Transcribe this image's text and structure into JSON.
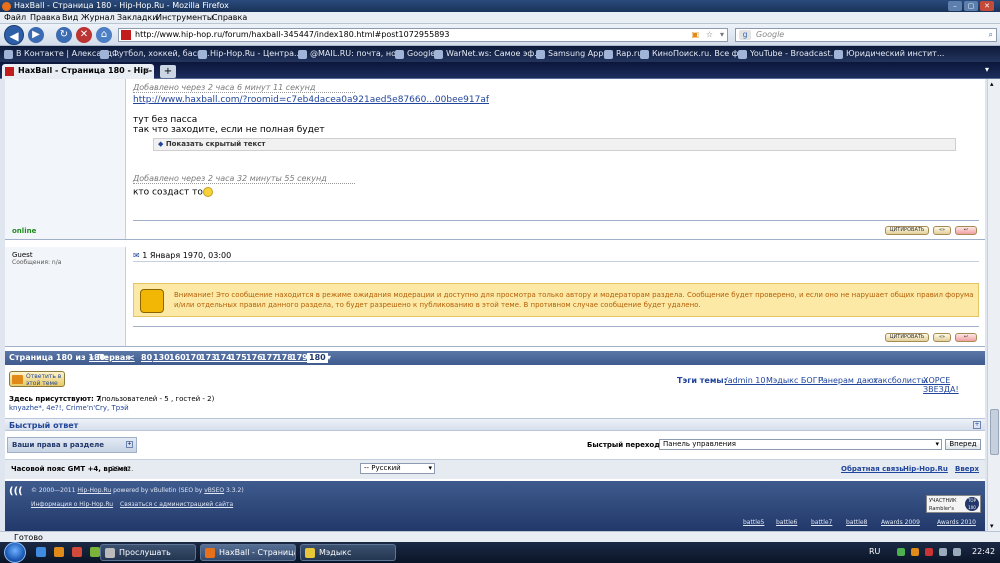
{
  "window": {
    "title": "HaxBall - Страница 180 - Hip-Hop.Ru - Mozilla Firefox"
  },
  "menu": [
    "Файл",
    "Правка",
    "Вид",
    "Журнал",
    "Закладки",
    "Инструменты",
    "Справка"
  ],
  "nav": {
    "url": "http://www.hip-hop.ru/forum/haxball-345447/index180.html#post1072955893",
    "search_placeholder": "Google"
  },
  "bookmarks": [
    "В Контакте | Александ...",
    "Футбол, хоккей, баск...",
    "Hip-Hop.Ru - Центра...",
    "@MAIL.RU: почта, но...",
    "Google",
    "WarNet.ws: Самое эф...",
    "Samsung Apps",
    "Rap.ru",
    "КиноПоиск.ru. Все ф...",
    "YouTube - Broadcast...",
    "Юридический инстит..."
  ],
  "tab": {
    "title": "HaxBall - Страница 180 - Hip-Hop.Ru",
    "new_tab_label": "+"
  },
  "post1": {
    "added1": "Добавлено через 2 часа 6 минут 11 секунд",
    "link": "http://www.haxball.com/?roomid=c7eb4dacea0a921aed5e87660...00bee917af",
    "line1": "тут без пасса",
    "line2": "так что заходите, если не полная будет",
    "hidden_label": "Показать скрытый текст",
    "added2": "Добавлено через 2 часа 32 минуты 55 секунд",
    "line3": "кто создаст то",
    "status": "online",
    "quote_label": "ЦИТИРОВАТЬ"
  },
  "post2": {
    "user": "Guest",
    "posts": "Сообщения: n/a",
    "date": "1 Января 1970, 03:00",
    "moderation_text": "Внимание! Это сообщение находится в режиме ожидания модерации и доступно для просмотра только автору и модераторам раздела. Сообщение будет проверено, и если оно не нарушает общих правил форума и/или отдельных правил данного раздела, то будет разрешено к публикованию в этой теме. В противном случае сообщение будет удалено.",
    "quote_label": "ЦИТИРОВАТЬ"
  },
  "pagination": {
    "label": "Страница 180 из 180:",
    "first": "« Первая",
    "prev": "<",
    "pages": [
      "80",
      "130",
      "160",
      "170",
      "173",
      "174",
      "175",
      "176",
      "177",
      "178",
      "179"
    ],
    "current": "180"
  },
  "reply_button": "Ответить в этой теме",
  "tags": {
    "label": "Тэги темы:",
    "items": [
      "/admin 10",
      "Мэдыкс БОГ!!",
      "Ранерам дают",
      "хаксболисты",
      "ХОРСЕ ЗВЕЗДА!"
    ]
  },
  "present": {
    "label": "Здесь присутствуют: 7",
    "detail": "(пользователей - 5 , гостей - 2)",
    "users": "knyazhe*, 4e?!, Crime'n'Cry, Трэй"
  },
  "quick_reply": "Быстрый ответ",
  "rights": "Ваши права в разделе",
  "quick_nav": {
    "label": "Быстрый переход",
    "selected": "Панель управления",
    "go": "Вперед"
  },
  "timezone": {
    "label": "Часовой пояс GMT +4, время:",
    "time": "22:42."
  },
  "language": "-- Русский",
  "footer_links": {
    "feedback": "Обратная связь",
    "site": "Hip-Hop.Ru",
    "top": "Вверх"
  },
  "footer": {
    "copyright_prefix": "© 2000—2011",
    "site": "Hip-Hop.Ru",
    "powered": "powered by vBulletin (SEO by",
    "vbseo": "vBSEO",
    "vbseo_ver": "3.3.2)",
    "info": "Информация о Hip-Hop.Ru",
    "contact": "Связаться с администрацией сайта",
    "rambler": "УЧАСТНИК Rambler's",
    "rambler_top": "TOP 100",
    "battles": [
      "battle5",
      "battle6",
      "battle7",
      "battle8",
      "Awards 2009",
      "Awards 2010"
    ]
  },
  "statusbar": "Готово",
  "taskbar": {
    "items": [
      "Прослушать",
      "HaxBall - Страница ...",
      "Мэдыкс"
    ],
    "lang": "RU",
    "clock": "22:42"
  }
}
